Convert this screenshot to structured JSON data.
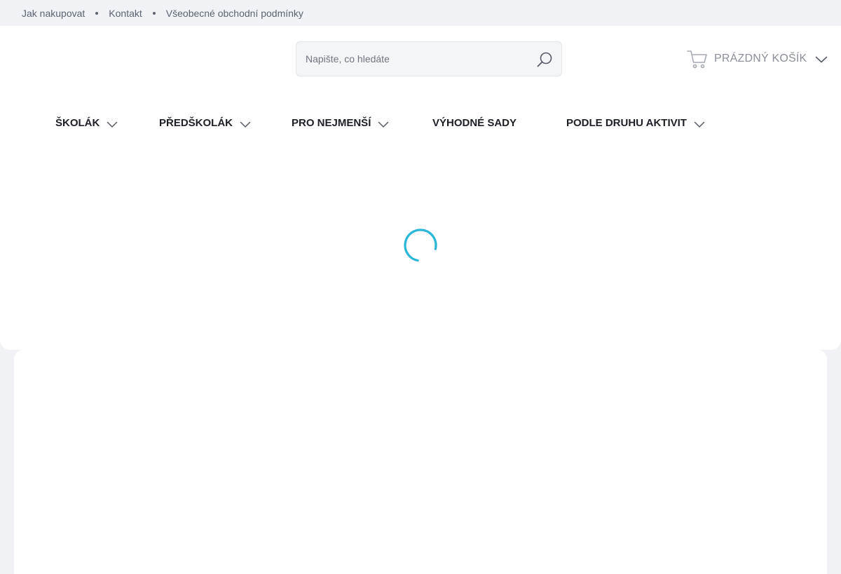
{
  "topbar": {
    "links": [
      "Jak nakupovat",
      "Kontakt",
      "Všeobecné obchodní podmínky"
    ]
  },
  "search": {
    "placeholder": "Napište, co hledáte",
    "value": "",
    "icon": "search-icon"
  },
  "cart": {
    "label": "PRÁZDNÝ KOŠÍK",
    "icon": "cart-icon"
  },
  "nav": {
    "items": [
      {
        "label": "ŠKOLÁK",
        "has_dropdown": true
      },
      {
        "label": "PŘEDŠKOLÁK",
        "has_dropdown": true
      },
      {
        "label": "PRO NEJMENŠÍ",
        "has_dropdown": true
      },
      {
        "label": "VÝHODNÉ SADY",
        "has_dropdown": false
      },
      {
        "label": "PODLE DRUHU AKTIVIT",
        "has_dropdown": true
      }
    ]
  },
  "loading": {
    "icon": "loading-spinner-icon"
  },
  "colors": {
    "background": "#f0f2f5",
    "surface": "#ffffff",
    "accent": "#29b6d8",
    "text": "#1c1f26",
    "muted": "#5b6270"
  }
}
